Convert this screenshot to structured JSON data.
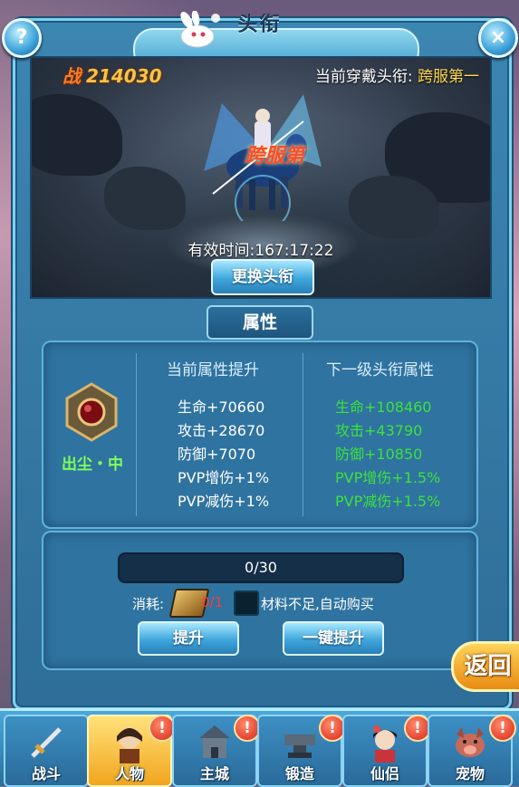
{
  "window": {
    "title": "头衔",
    "help_label": "?",
    "close_label": "×"
  },
  "scene": {
    "power_icon": "战",
    "power_value": "214030",
    "current_title_label": "当前穿戴头衔:",
    "current_title_value": "跨服第一",
    "duration_label": "有效时间:167:17:22",
    "change_button": "更换头衔",
    "banner_text": "跨服第"
  },
  "attributes": {
    "tab_label": "属性",
    "tier": "出尘・中",
    "current_header": "当前属性提升",
    "next_header": "下一级头衔属性",
    "current": [
      "生命+70660",
      "攻击+28670",
      "防御+7070",
      "PVP增伤+1%",
      "PVP减伤+1%"
    ],
    "next": [
      "生命+108460",
      "攻击+43790",
      "防御+10850",
      "PVP增伤+1.5%",
      "PVP减伤+1.5%"
    ]
  },
  "upgrade": {
    "progress_text": "0/30",
    "progress_fraction": 0,
    "cost_label": "消耗:",
    "cost_count": "0/1",
    "autobuy_label": "材料不足,自动购买",
    "upgrade_button": "提升",
    "one_click_button": "一键提升"
  },
  "return_button": "返回",
  "nav": [
    {
      "label": "战斗",
      "icon": "sword-icon",
      "alert": false
    },
    {
      "label": "人物",
      "icon": "character-icon",
      "alert": true
    },
    {
      "label": "主城",
      "icon": "castle-icon",
      "alert": true
    },
    {
      "label": "锻造",
      "icon": "anvil-icon",
      "alert": true
    },
    {
      "label": "仙侣",
      "icon": "companion-icon",
      "alert": true
    },
    {
      "label": "宠物",
      "icon": "pet-icon",
      "alert": true
    }
  ],
  "alert_mark": "!",
  "colors": {
    "panel_blue": "#2f73a0",
    "next_stat_green": "#3de13d",
    "title_gold": "#ffda4a",
    "alert_red": "#d8261a"
  }
}
